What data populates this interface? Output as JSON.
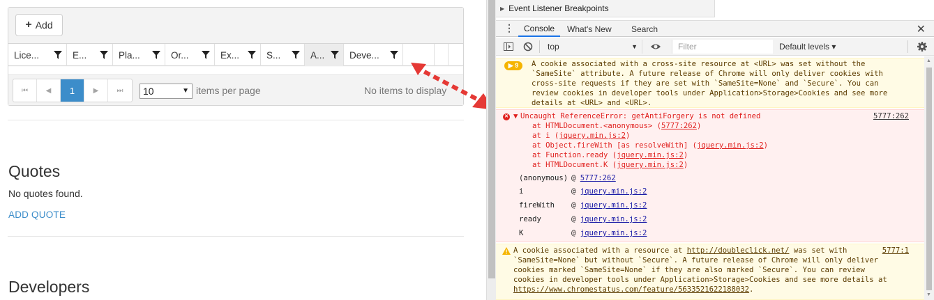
{
  "grid": {
    "add_label": "Add",
    "columns": [
      "Lice...",
      "E...",
      "Pla...",
      "Or...",
      "Ex...",
      "S...",
      "A...",
      "Deve..."
    ],
    "pager": {
      "first": "⏮",
      "prev": "◀",
      "current": "1",
      "next": "▶",
      "last": "⏭",
      "page_size": "10",
      "items_per_page": "items per page",
      "info": "No items to display"
    }
  },
  "sections": {
    "quotes_title": "Quotes",
    "quotes_empty": "No quotes found.",
    "add_quote": "ADD QUOTE",
    "developers_title": "Developers"
  },
  "devtools": {
    "event_listener_breakpoints": "Event Listener Breakpoints",
    "tabs": [
      "Console",
      "What's New",
      "Search"
    ],
    "context": "top",
    "filter_placeholder": "Filter",
    "levels": "Default levels ▾",
    "messages": {
      "warn1": {
        "count": "9",
        "lines": [
          "A cookie associated with a cross-site resource at <URL> was set without the",
          "`SameSite` attribute. A future release of Chrome will only deliver cookies with",
          "cross-site requests if they are set with `SameSite=None` and `Secure`. You can",
          "review cookies in developer tools under Application>Storage>Cookies and see more",
          "details at <URL> and <URL>."
        ]
      },
      "error": {
        "title": "Uncaught ReferenceError: getAntiForgery is not defined",
        "source": "5777:262",
        "stack": [
          {
            "pre": "at HTMLDocument.<anonymous> (",
            "link": "5777:262",
            "post": ")"
          },
          {
            "pre": "at i (",
            "link": "jquery.min.js:2",
            "post": ")"
          },
          {
            "pre": "at Object.fireWith [as resolveWith] (",
            "link": "jquery.min.js:2",
            "post": ")"
          },
          {
            "pre": "at Function.ready (",
            "link": "jquery.min.js:2",
            "post": ")"
          },
          {
            "pre": "at HTMLDocument.K (",
            "link": "jquery.min.js:2",
            "post": ")"
          }
        ],
        "frames": [
          {
            "fn": "(anonymous)",
            "link": "5777:262"
          },
          {
            "fn": "i",
            "link": "jquery.min.js:2"
          },
          {
            "fn": "fireWith",
            "link": "jquery.min.js:2"
          },
          {
            "fn": "ready",
            "link": "jquery.min.js:2"
          },
          {
            "fn": "K",
            "link": "jquery.min.js:2"
          }
        ]
      },
      "warn2": {
        "source": "5777:1",
        "line1_pre": "A cookie associated with a resource at ",
        "line1_link": "http://doubleclick.net/",
        "line1_post": " was set with",
        "lines": [
          "`SameSite=None` but without `Secure`. A future release of Chrome will only deliver",
          "cookies marked `SameSite=None` if they are also marked `Secure`. You can review",
          "cookies in developer tools under Application>Storage>Cookies and see more details at"
        ],
        "last_link": "https://www.chromestatus.com/feature/5633521622188032",
        "last_post": "."
      }
    }
  },
  "colors": {
    "accent": "#3c8dca",
    "error": "#e0211f",
    "warning_bg": "#fffbe5",
    "arrow": "#e53935"
  }
}
